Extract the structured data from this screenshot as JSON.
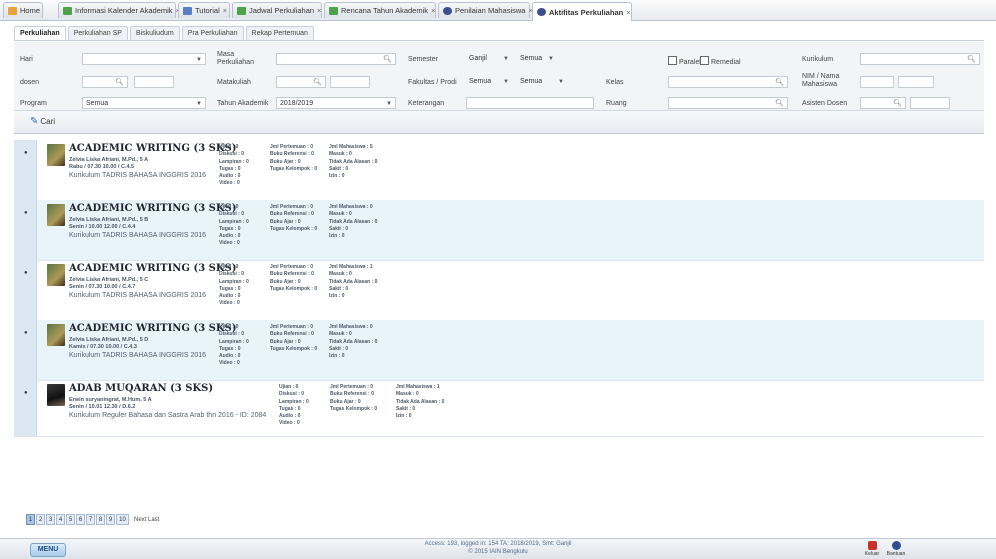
{
  "tabs": [
    {
      "label": "Home",
      "color": "#e8a33a",
      "close": ""
    },
    {
      "label": "Informasi Kalender Akademik",
      "color": "#4fa24a",
      "close": "×"
    },
    {
      "label": "Tutorial",
      "color": "#5b7dc3",
      "close": "×"
    },
    {
      "label": "Jadwal Perkuliahan",
      "color": "#4fa24a",
      "close": "×"
    },
    {
      "label": "Rencana Tahun Akademik",
      "color": "#4fa24a",
      "close": "×"
    },
    {
      "label": "Penilaian Mahasiswa",
      "color": "#3c4f8c",
      "close": "×"
    },
    {
      "label": "Aktifitas Perkuliahan",
      "color": "#3c4f8c",
      "close": "×"
    }
  ],
  "subtabs": [
    "Perkuliahan",
    "Perkuliahan SP",
    "Biskuliudum",
    "Pra Perkuliahan",
    "Rekap Pertemuan"
  ],
  "filter": {
    "hari_label": "Hari",
    "masa_label": "Masa Perkuliahan",
    "semester_label": "Semester",
    "semester_value": "Ganjil",
    "semester_sub": "Semua",
    "paralel_label": "Paralel",
    "remedial_label": "Remedial",
    "kurikulum_label": "Kurikulum",
    "dosen_label": "dosen",
    "matakuliah_label": "Matakuliah",
    "fakultas_label": "Fakultas / Prodi",
    "fakultas_value": "Semua",
    "prodi_value": "Semua",
    "kelas_label": "Kelas",
    "nim_label": "NIM / Nama Mahasiswa",
    "program_label": "Program",
    "program_value": "Semua",
    "tahun_label": "Tahun Akademik",
    "tahun_value": "2018/2019",
    "keterangan_label": "Keterangan",
    "ruang_label": "Ruang",
    "asisten_label": "Asisten Dosen",
    "cari_label": "Cari"
  },
  "courses": [
    {
      "title": "ACADEMIC WRITING (3 SKS)",
      "lecturer": "Zelvia Liska Afriani, M.Pd., 5 A",
      "schedule": "Rabu / 07.30 10.00 / C.4.5",
      "curriculum": "Kurikulum TADRIS BAHASA INGGRIS 2016",
      "col1": [
        "Ujian : 0",
        "Diskusi : 0",
        "Lampiran : 0",
        "Tugas : 0",
        "Audio : 0",
        "Video : 0"
      ],
      "col2": [
        "Jml Pertemuan : 0",
        "Buku Referensi : 0",
        "Buku Ajar : 0",
        "Tugas Kelompok : 0"
      ],
      "col3": [
        "Jml Mahasiswa : 5",
        "Masuk : 0",
        "Tidak Ada Alasan : 0",
        "Sakit : 0",
        "Izin : 0"
      ]
    },
    {
      "title": "ACADEMIC WRITING (3 SKS)",
      "lecturer": "Zelvia Liska Afriani, M.Pd., 5 B",
      "schedule": "Senin / 10.00 12.00 / C.4.4",
      "curriculum": "Kurikulum TADRIS BAHASA INGGRIS 2016",
      "col1": [
        "Ujian : 0",
        "Diskusi : 0",
        "Lampiran : 0",
        "Tugas : 0",
        "Audio : 0",
        "Video : 0"
      ],
      "col2": [
        "Jml Pertemuan : 0",
        "Buku Referensi : 0",
        "Buku Ajar : 0",
        "Tugas Kelompok : 0"
      ],
      "col3": [
        "Jml Mahasiswa : 0",
        "Masuk : 0",
        "Tidak Ada Alasan : 0",
        "Sakit : 0",
        "Izin : 0"
      ]
    },
    {
      "title": "ACADEMIC WRITING (3 SKS)",
      "lecturer": "Zelvia Liska Afriani, M.Pd., 5 C",
      "schedule": "Senin / 07.30 10.00 / C.4.7",
      "curriculum": "Kurikulum TADRIS BAHASA INGGRIS 2016",
      "col1": [
        "Ujian : 0",
        "Diskusi : 0",
        "Lampiran : 0",
        "Tugas : 0",
        "Audio : 0",
        "Video : 0"
      ],
      "col2": [
        "Jml Pertemuan : 0",
        "Buku Referensi : 0",
        "Buku Ajar : 0",
        "Tugas Kelompok : 0"
      ],
      "col3": [
        "Jml Mahasiswa : 1",
        "Masuk : 0",
        "Tidak Ada Alasan : 0",
        "Sakit : 0",
        "Izin : 0"
      ]
    },
    {
      "title": "ACADEMIC WRITING (3 SKS)",
      "lecturer": "Zelvia Liska Afriani, M.Pd., 5 D",
      "schedule": "Kamis / 07.30 10.00 / C.4.3",
      "curriculum": "Kurikulum TADRIS BAHASA INGGRIS 2016",
      "col1": [
        "Ujian : 0",
        "Diskusi : 0",
        "Lampiran : 0",
        "Tugas : 0",
        "Audio : 0",
        "Video : 0"
      ],
      "col2": [
        "Jml Pertemuan : 0",
        "Buku Referensi : 0",
        "Buku Ajar : 0",
        "Tugas Kelompok : 0"
      ],
      "col3": [
        "Jml Mahasiswa : 0",
        "Masuk : 0",
        "Tidak Ada Alasan : 0",
        "Sakit : 0",
        "Izin : 0"
      ]
    },
    {
      "title": "ADAB MUQARAN (3 SKS)",
      "lecturer": "Erwin suryaningrat, M.Hum, 5 A",
      "schedule": "Senin / 10.01 12.30 / D.6.2",
      "curriculum": "Kurikulum Reguler Bahasa dan Sastra Arab thn 2016 - ID: 2084",
      "col1": [
        "Ujian : 0",
        "Diskusi : 0",
        "Lampiran : 0",
        "Tugas : 0",
        "Audio : 0",
        "Video : 0"
      ],
      "col2": [
        "Jml Pertemuan : 0",
        "Buku Referensi : 0",
        "Buku Ajar : 0",
        "Tugas Kelompok : 0"
      ],
      "col3": [
        "Jml Mahasiswa : 1",
        "Masuk : 0",
        "Tidak Ada Alasan : 0",
        "Sakit : 0",
        "Izin : 0"
      ]
    }
  ],
  "pagination": {
    "pages": [
      "1",
      "2",
      "3",
      "4",
      "5",
      "6",
      "7",
      "8",
      "9",
      "10"
    ],
    "current": "1",
    "next_label": "Next Last"
  },
  "footer": {
    "menu_label": "MENU",
    "status_line1": "Access: 193, logged in: 154 TA: 2018/2019, Smt: Ganjil",
    "status_line2": "© 2015 IAIN Bengkulu",
    "keluar_label": "Keluar",
    "bantuan_label": "Bantuan"
  }
}
